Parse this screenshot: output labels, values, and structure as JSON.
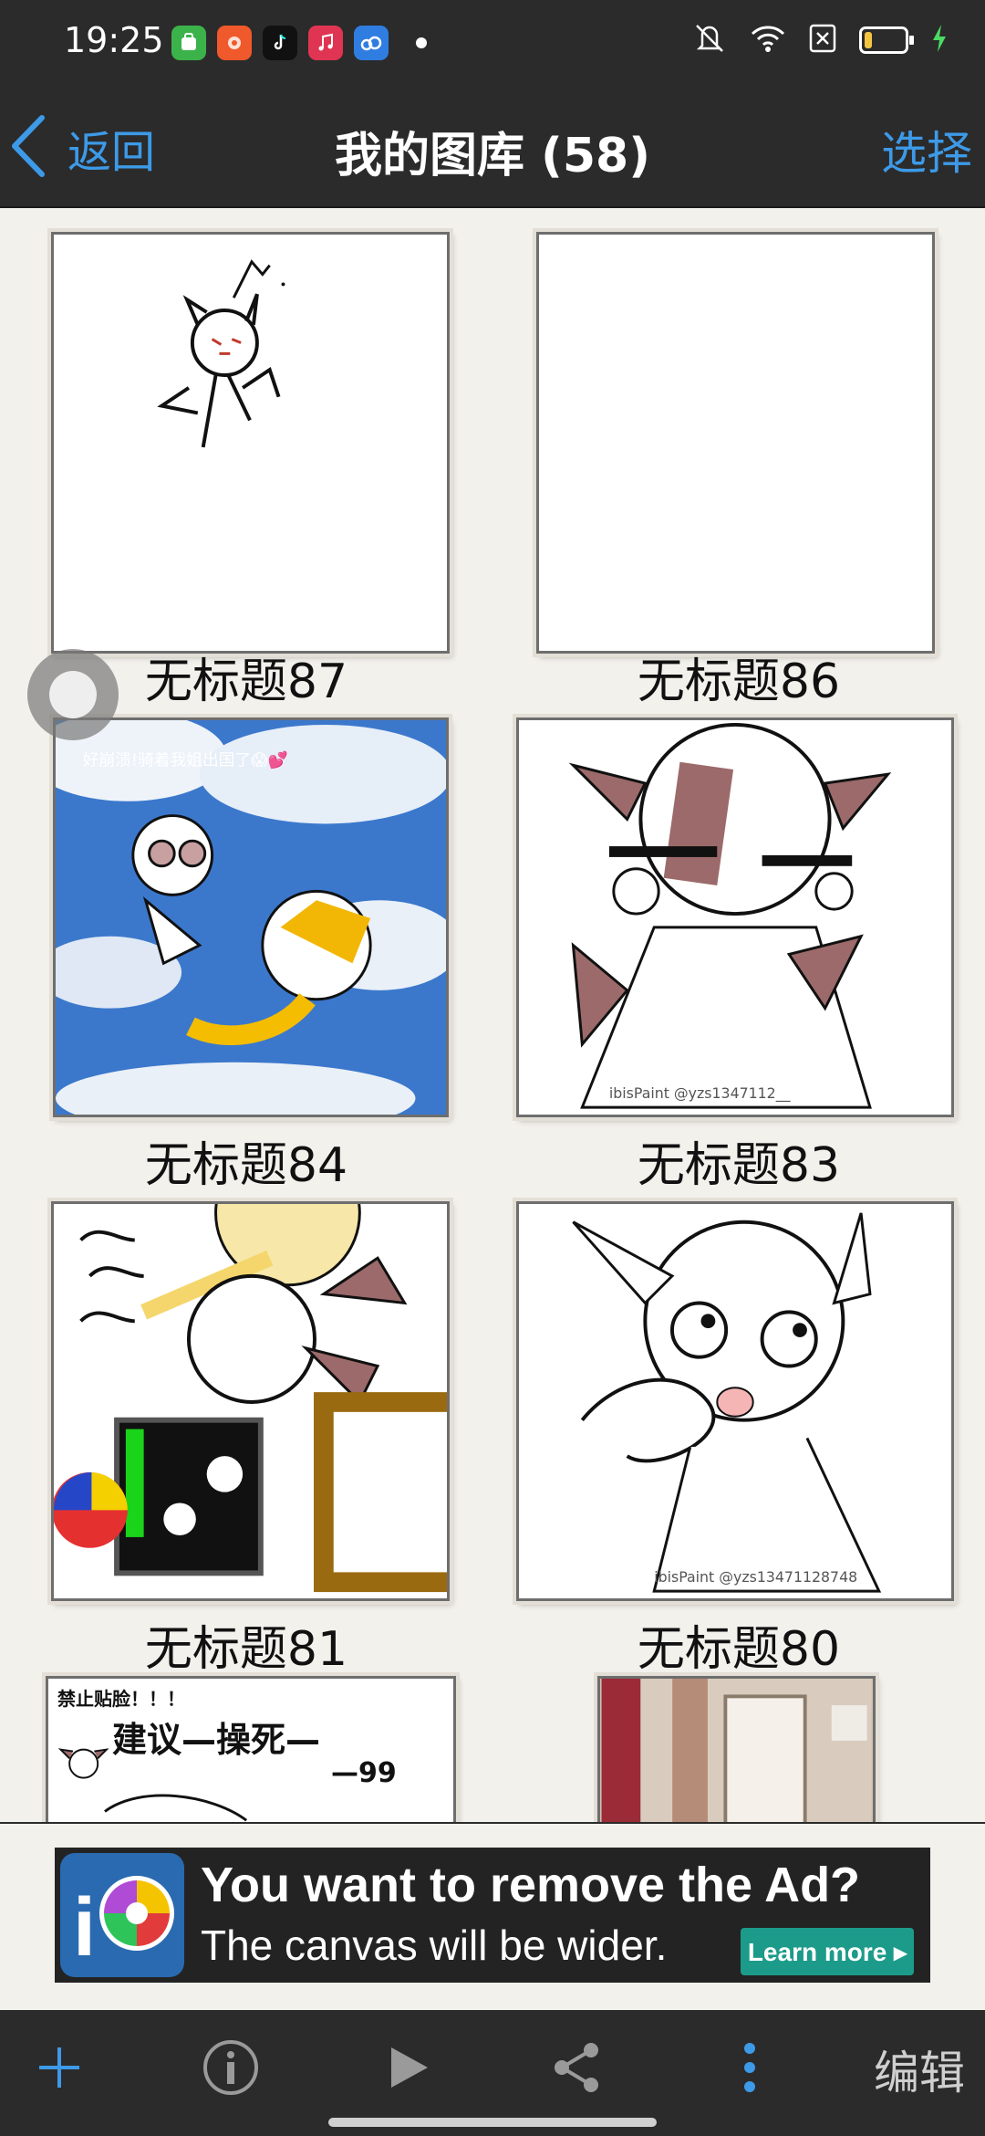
{
  "status_bar": {
    "time": "19:25",
    "apps": [
      {
        "icon": "wechat-app-icon",
        "color": "#3cb34a"
      },
      {
        "icon": "photo-app-icon",
        "color": "#f0592b"
      },
      {
        "icon": "tiktok-app-icon",
        "color": "#111111"
      },
      {
        "icon": "music-app-icon",
        "color": "#e03552"
      },
      {
        "icon": "cloud-app-icon",
        "color": "#2f7de1"
      }
    ],
    "indicators": [
      "mute-icon",
      "wifi-icon",
      "sim-off-icon",
      "battery-icon",
      "charging-icon"
    ],
    "battery_level": 0.2
  },
  "nav": {
    "back_label": "返回",
    "title": "我的图库 (58)",
    "select_label": "选择"
  },
  "gallery": {
    "items": [
      {
        "title": "无标题87"
      },
      {
        "title": "无标题86"
      },
      {
        "title": "无标题84",
        "overlay_text": "好崩溃!骑着我姐出国了😱💕"
      },
      {
        "title": "无标题83",
        "watermark": "ibisPaint @yzs1347112__"
      },
      {
        "title": "无标题81"
      },
      {
        "title": "无标题80",
        "watermark": "ibisPaint @yzs13471128748"
      },
      {
        "title": "",
        "overlay_lines": [
          "禁止贴脸！！！",
          "建议—操死—",
          "—99"
        ]
      },
      {
        "title": ""
      }
    ]
  },
  "ad": {
    "headline": "You want to remove the Ad?",
    "subtext": "The canvas will be wider.",
    "cta": "Learn more ▸"
  },
  "toolbar": {
    "edit_label": "编辑",
    "icons": [
      "add-icon",
      "info-icon",
      "play-icon",
      "share-icon",
      "more-vertical-icon"
    ]
  },
  "colors": {
    "accent": "#3d9ae8",
    "bar_background": "#2b2b2b",
    "page_background": "#f3f1ec",
    "ad_cta": "#1c9b8a"
  }
}
